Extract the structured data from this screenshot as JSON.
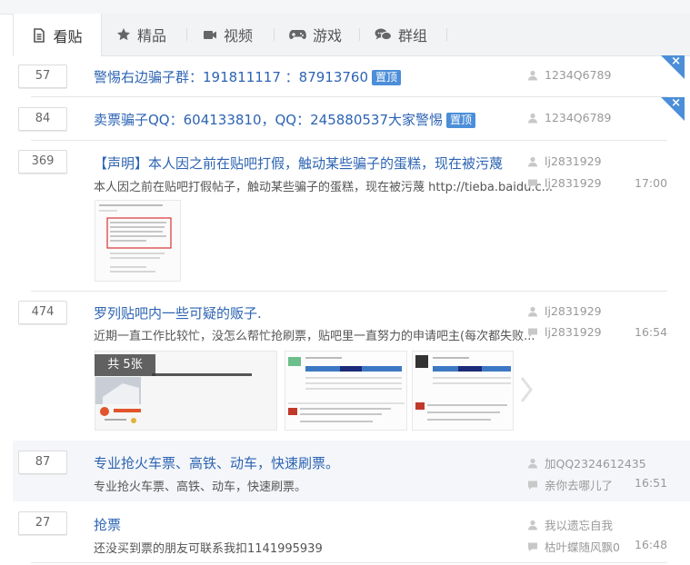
{
  "tabs": [
    {
      "label": "看贴",
      "icon": "document-icon"
    },
    {
      "label": "精品",
      "icon": "star-icon"
    },
    {
      "label": "视频",
      "icon": "video-camera-icon"
    },
    {
      "label": "游戏",
      "icon": "gamepad-icon"
    },
    {
      "label": "群组",
      "icon": "chat-bubbles-icon"
    }
  ],
  "threads": [
    {
      "reply_count": "57",
      "title": "警惕右边骗子群：191811117 ：87913760",
      "badge": "置顶",
      "author": "1234Q6789",
      "corner_close": "×"
    },
    {
      "reply_count": "84",
      "title": "卖票骗子QQ：604133810，QQ：245880537大家警惕",
      "badge": "置顶",
      "author": "1234Q6789",
      "corner_close": "×"
    },
    {
      "reply_count": "369",
      "title": "【声明】本人因之前在贴吧打假，触动某些骗子的蛋糕，现在被污蔑",
      "abstract": "本人因之前在贴吧打假帖子，触动某些骗子的蛋糕，现在被污蔑 http://tieba.baidu.c...",
      "author": "lj2831929",
      "last_replier": "lj2831929",
      "time": "17:00"
    },
    {
      "reply_count": "474",
      "title": "罗列贴吧内一些可疑的贩子.",
      "abstract": "近期一直工作比较忙，没怎么帮忙抢刷票，贴吧里一直努力的申请吧主(每次都失败...",
      "author": "lj2831929",
      "last_replier": "lj2831929",
      "time": "16:54",
      "photo_count": "共 5张"
    },
    {
      "reply_count": "87",
      "title": "专业抢火车票、高铁、动车，快速刷票。",
      "abstract": "专业抢火车票、高铁、动车，快速刷票。",
      "author": "加QQ2324612435",
      "last_replier": "亲你去哪儿了",
      "time": "16:51"
    },
    {
      "reply_count": "27",
      "title": "抢票",
      "abstract": "还没买到票的朋友可联系我扣1141995939",
      "author": "我以遗忘自我",
      "last_replier": "枯叶蝶随风飘0",
      "time": "16:48"
    }
  ],
  "colors": {
    "link": "#2d64b3",
    "badge": "#4c8ed8",
    "muted": "#999999"
  }
}
